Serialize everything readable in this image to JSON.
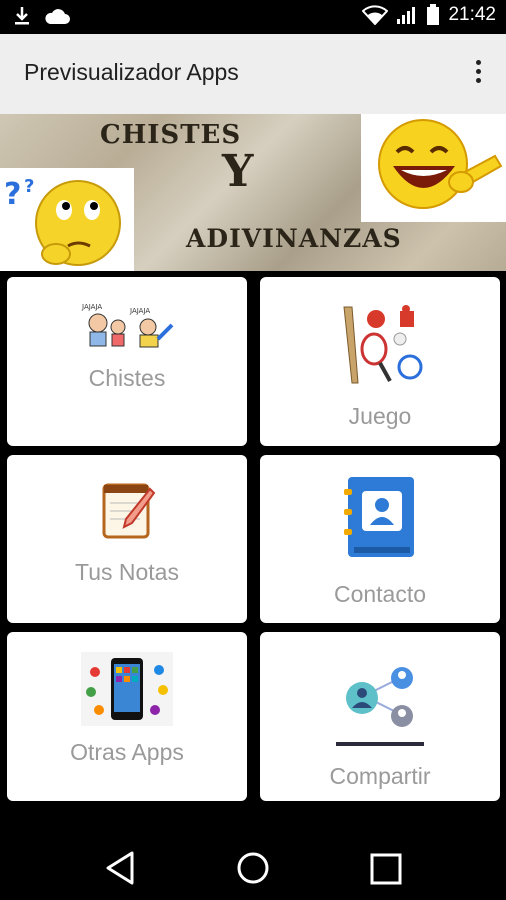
{
  "status_bar": {
    "time": "21:42",
    "icons_left": [
      "download-icon",
      "cloud-icon"
    ],
    "icons_right": [
      "wifi-icon",
      "signal-icon",
      "battery-icon"
    ]
  },
  "app_bar": {
    "title": "Previsualizador Apps",
    "menu_icon": "more-vert-icon"
  },
  "banner": {
    "line1": "CHISTES",
    "line2": "Y",
    "line3": "ADIVINANZAS"
  },
  "menu": [
    {
      "label": "Chistes",
      "icon": "laughing-people-icon"
    },
    {
      "label": "Juego",
      "icon": "sports-equipment-icon"
    },
    {
      "label": "Tus Notas",
      "icon": "notepad-pencil-icon"
    },
    {
      "label": "Contacto",
      "icon": "contact-book-icon"
    },
    {
      "label": "Otras Apps",
      "icon": "smartphone-apps-icon"
    },
    {
      "label": "Compartir",
      "icon": "share-network-icon"
    }
  ],
  "nav_bar": {
    "back": "back-icon",
    "home": "home-icon",
    "recents": "recents-icon"
  }
}
